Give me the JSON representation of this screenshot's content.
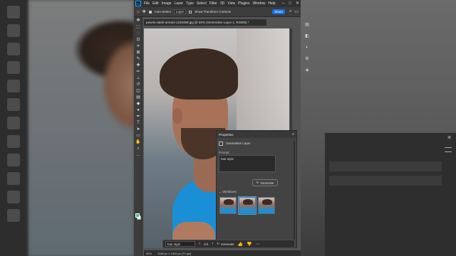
{
  "menubar": {
    "items": [
      "File",
      "Edit",
      "Image",
      "Layer",
      "Type",
      "Select",
      "Filter",
      "3D",
      "View",
      "Plugins",
      "Window",
      "Help"
    ]
  },
  "options_bar": {
    "auto_select_label": "Auto-Select",
    "layer_select": "Layer",
    "transform_label": "Show Transform Controls",
    "share_label": "Share"
  },
  "document": {
    "tab_title": "pexels-salah-amrani-1232459.jpg @ 50% (Generative Layer 1, RGB/8) *"
  },
  "status_bar": {
    "zoom": "50%",
    "dimensions": "1080 px x 1920 px (72 ppi)"
  },
  "contextual_bar": {
    "prompt_value": "hair style",
    "variation_counter": "2/3",
    "generate_label": "Generate"
  },
  "properties_panel": {
    "title": "Properties",
    "layer_type": "Generative Layer",
    "prompt_label": "Prompt",
    "prompt_value": "hair style",
    "generate_label": "Generate",
    "variations_label": "Variations",
    "variation_count": 3,
    "selected_variation": 2
  },
  "colors": {
    "foreground_swatch": "#4bc27a",
    "background_swatch": "#ffffff",
    "accent": "#1473e6"
  }
}
